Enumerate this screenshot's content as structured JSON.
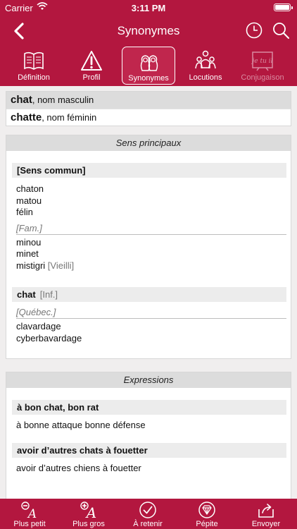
{
  "status": {
    "carrier": "Carrier",
    "time": "3:11 PM"
  },
  "nav": {
    "title": "Synonymes"
  },
  "tabs": [
    {
      "label": "Définition",
      "icon": "book-icon"
    },
    {
      "label": "Profil",
      "icon": "warning-icon"
    },
    {
      "label": "Synonymes",
      "icon": "dolls-icon"
    },
    {
      "label": "Locutions",
      "icon": "people-icon"
    },
    {
      "label": "Conjugaison",
      "icon": "board-icon",
      "board_text": "je tu il"
    }
  ],
  "entry": {
    "hw1": {
      "word": "chat",
      "pos": ", nom masculin"
    },
    "hw2": {
      "word": "chatte",
      "pos": ", nom féminin"
    }
  },
  "sens": {
    "caption": "Sens principaux",
    "group1": {
      "head": "[Sens commun]",
      "words": [
        "chaton",
        "matou",
        "félin"
      ],
      "register": "[Fam.]",
      "words2": [
        "minou",
        "minet",
        "mistigri"
      ],
      "tag": "[Vieilli]"
    },
    "group2": {
      "head": "chat",
      "head_tag": "[Inf.]",
      "register": "[Québec.]",
      "words": [
        "clavardage",
        "cyberbavardage"
      ]
    }
  },
  "expressions": {
    "caption": "Expressions",
    "items": [
      {
        "head": "à bon chat, bon rat",
        "text": "à bonne attaque bonne défense"
      },
      {
        "head": "avoir d’autres chats à fouetter",
        "text": "avoir d’autres chiens à fouetter"
      }
    ]
  },
  "bottom": [
    {
      "label": "Plus petit",
      "icon": "text-smaller-icon"
    },
    {
      "label": "Plus gros",
      "icon": "text-bigger-icon"
    },
    {
      "label": "À retenir",
      "icon": "check-circle-icon"
    },
    {
      "label": "Pépite",
      "icon": "diamond-icon"
    },
    {
      "label": "Envoyer",
      "icon": "share-icon"
    }
  ],
  "colors": {
    "brand": "#b3173f",
    "caption_bg": "#dcdcdc",
    "tag_grey": "#777777"
  }
}
